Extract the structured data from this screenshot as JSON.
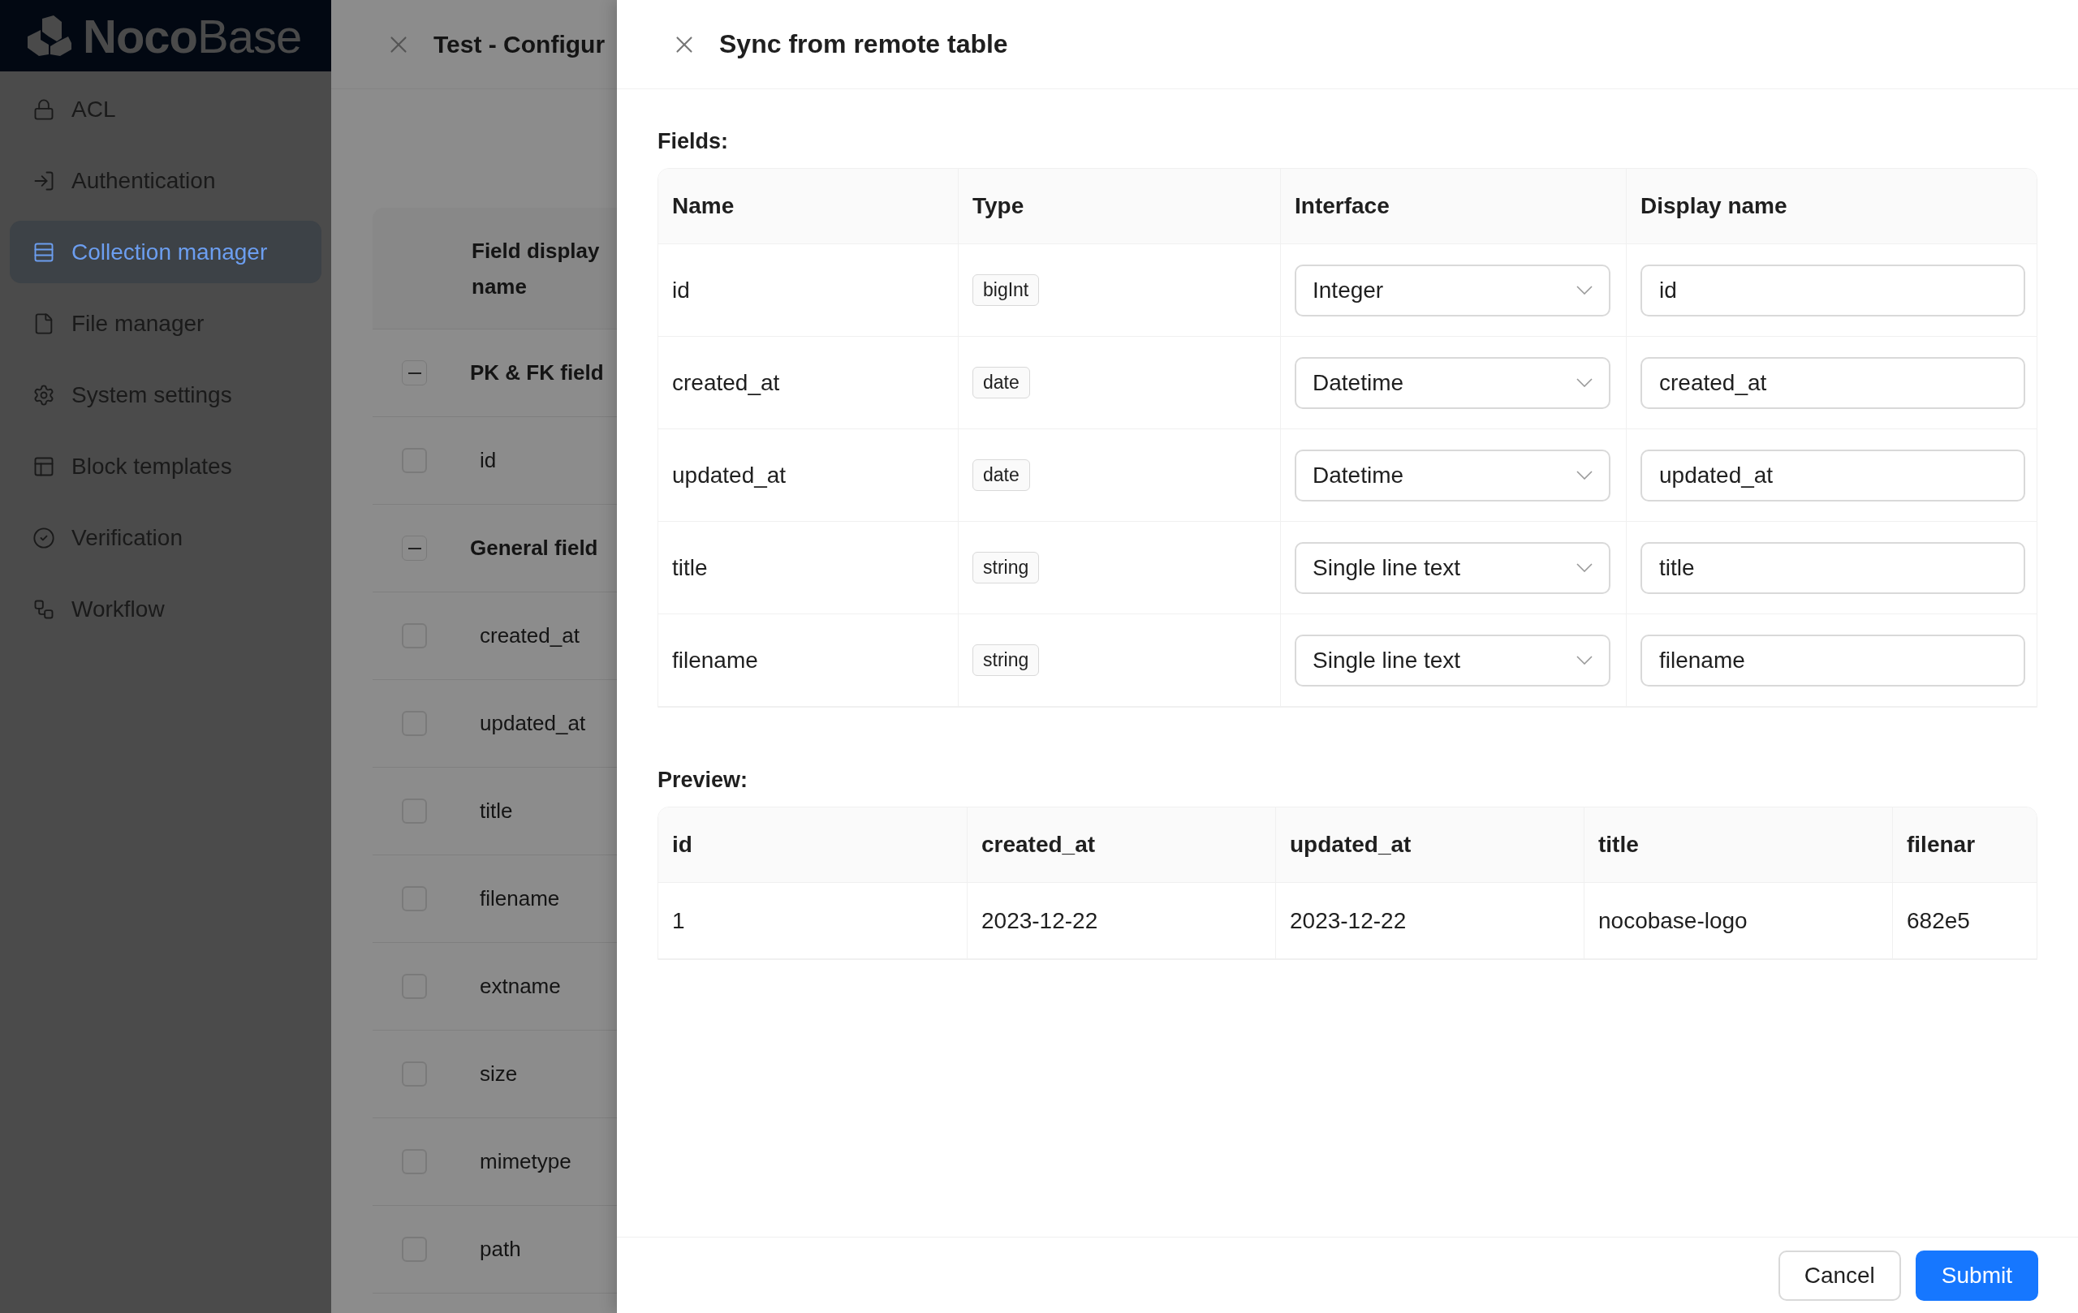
{
  "sidebar": {
    "logo": "**Noco**Base",
    "items": [
      {
        "label": "ACL",
        "selected": false
      },
      {
        "label": "Authentication",
        "selected": false
      },
      {
        "label": "Collection manager",
        "selected": true
      },
      {
        "label": "File manager",
        "selected": false
      },
      {
        "label": "System settings",
        "selected": false
      },
      {
        "label": "Block templates",
        "selected": false
      },
      {
        "label": "Verification",
        "selected": false
      },
      {
        "label": "Workflow",
        "selected": false
      }
    ]
  },
  "configure_drawer": {
    "title": "Test - Configur",
    "column_header": "Field display name",
    "rows": [
      {
        "kind": "group",
        "label": "PK & FK field",
        "expanded": true
      },
      {
        "kind": "field",
        "label": "id",
        "checked": false
      },
      {
        "kind": "group",
        "label": "General field",
        "expanded": true
      },
      {
        "kind": "field",
        "label": "created_at",
        "checked": false
      },
      {
        "kind": "field",
        "label": "updated_at",
        "checked": false
      },
      {
        "kind": "field",
        "label": "title",
        "checked": false
      },
      {
        "kind": "field",
        "label": "filename",
        "checked": false
      },
      {
        "kind": "field",
        "label": "extname",
        "checked": false
      },
      {
        "kind": "field",
        "label": "size",
        "checked": false
      },
      {
        "kind": "field",
        "label": "mimetype",
        "checked": false
      },
      {
        "kind": "field",
        "label": "path",
        "checked": false
      }
    ]
  },
  "sync_drawer": {
    "title": "Sync from remote table",
    "fields_label": "Fields:",
    "fields": {
      "columns": [
        "Name",
        "Type",
        "Interface",
        "Display name"
      ],
      "rows": [
        {
          "name": "id",
          "type": "bigInt",
          "interface": "Integer",
          "display_name": "id"
        },
        {
          "name": "created_at",
          "type": "date",
          "interface": "Datetime",
          "display_name": "created_at"
        },
        {
          "name": "updated_at",
          "type": "date",
          "interface": "Datetime",
          "display_name": "updated_at"
        },
        {
          "name": "title",
          "type": "string",
          "interface": "Single line text",
          "display_name": "title"
        },
        {
          "name": "filename",
          "type": "string",
          "interface": "Single line text",
          "display_name": "filename"
        }
      ]
    },
    "preview_label": "Preview:",
    "preview": {
      "columns": [
        "id",
        "created_at",
        "updated_at",
        "title",
        "filenar"
      ],
      "rows": [
        [
          "1",
          "2023-12-22",
          "2023-12-22",
          "nocobase-logo",
          "682e5"
        ]
      ]
    },
    "buttons": [
      {
        "label": "Cancel",
        "kind": "default"
      },
      {
        "label": "Submit",
        "kind": "primary"
      }
    ]
  }
}
